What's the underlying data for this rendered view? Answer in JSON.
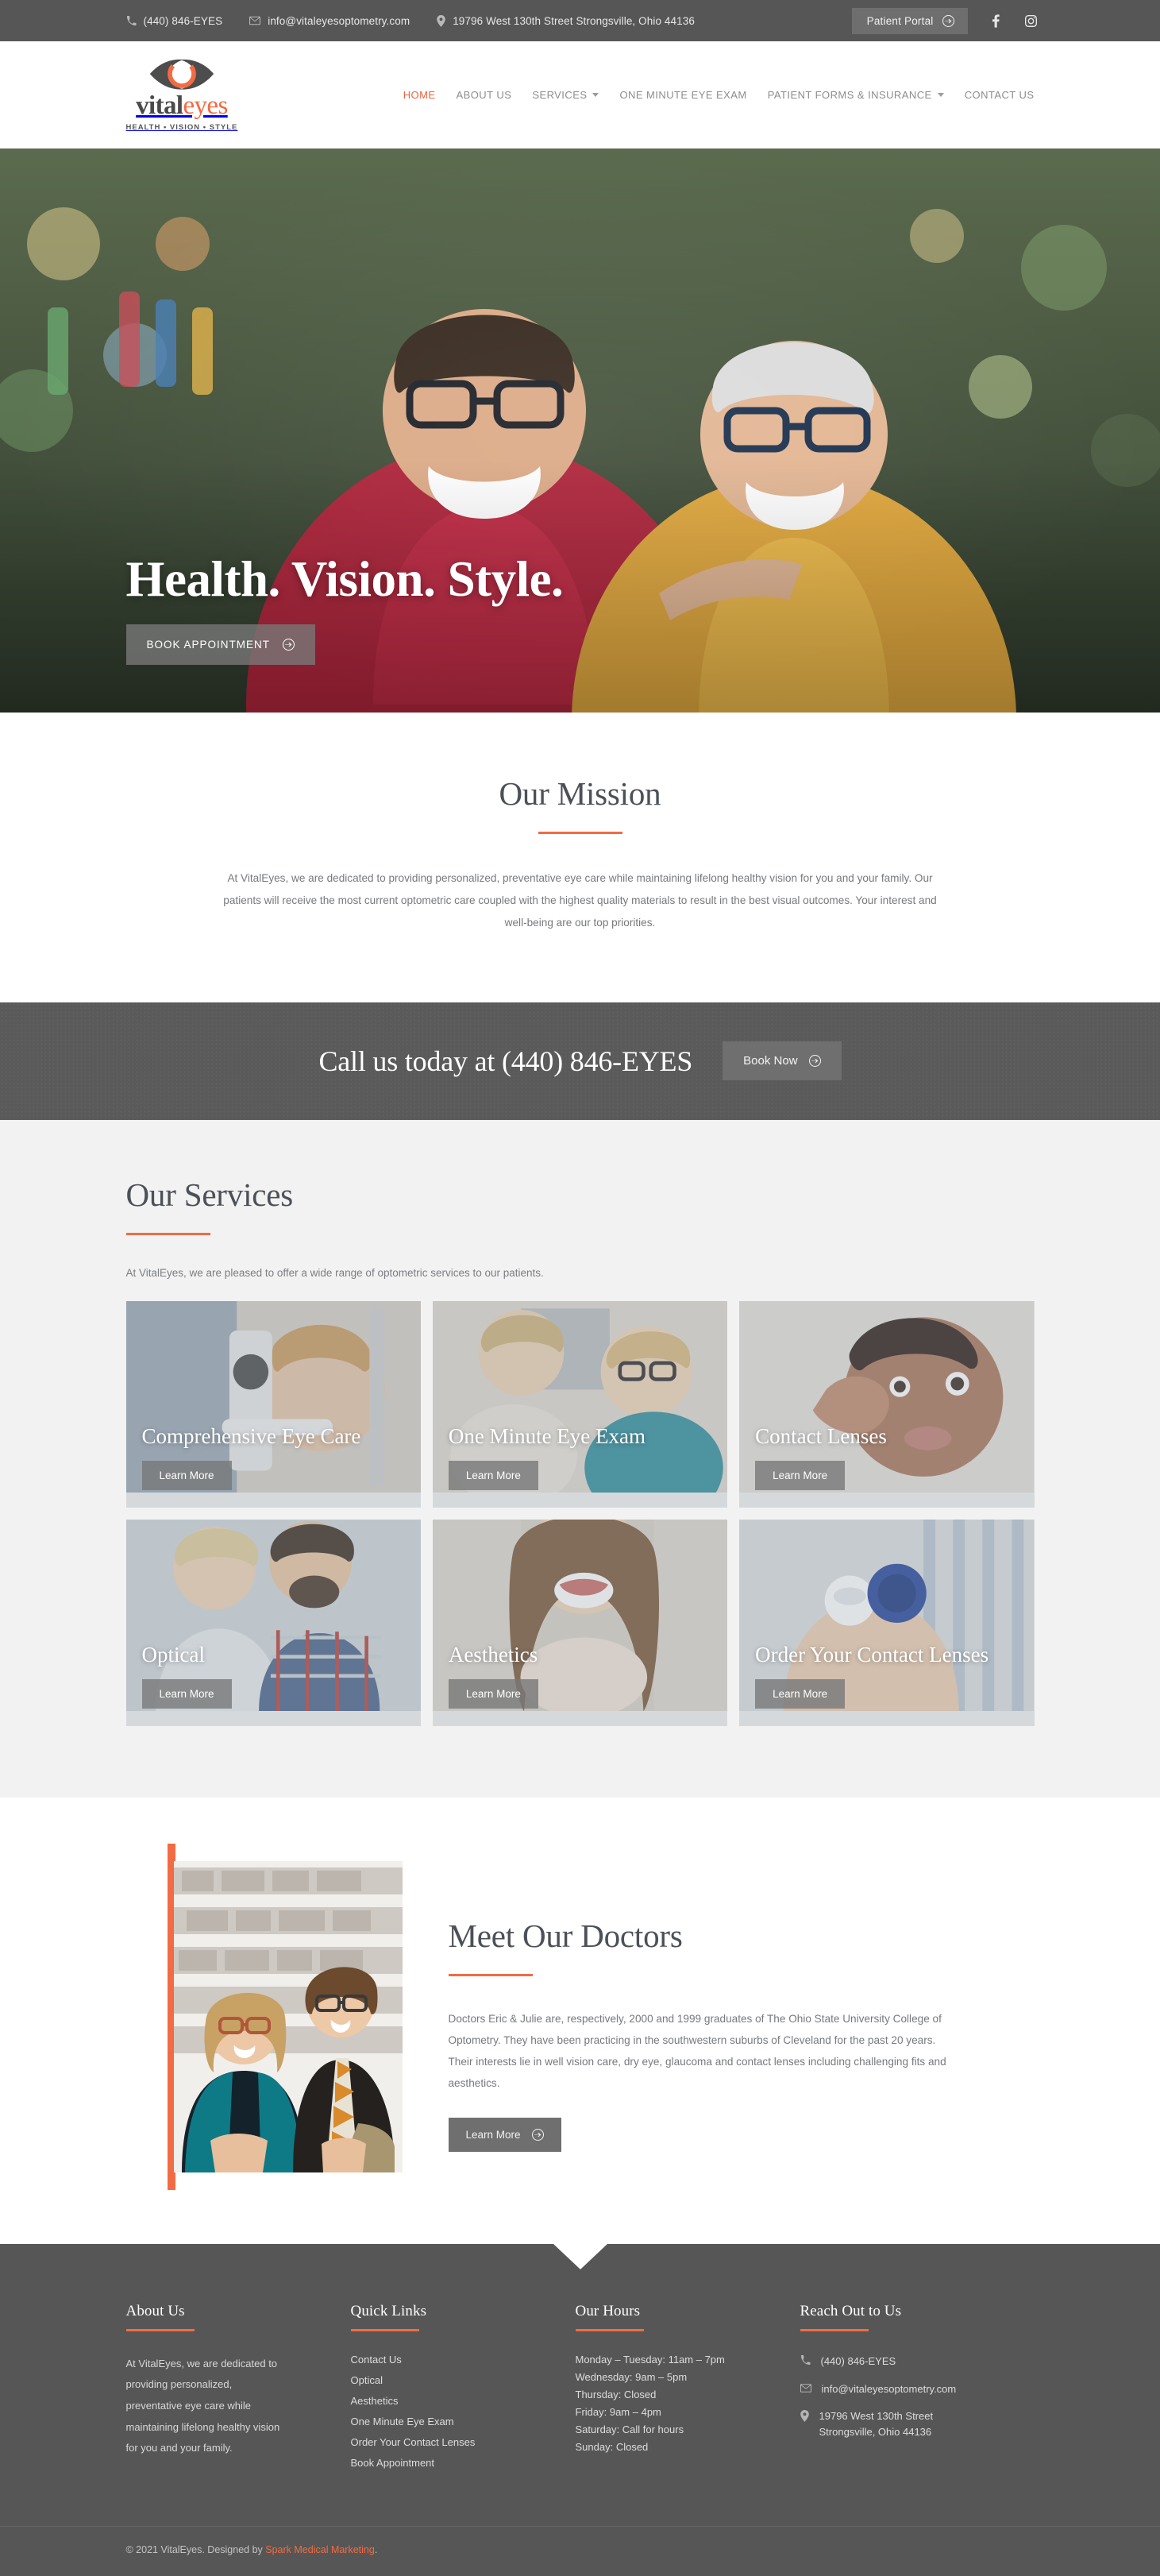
{
  "colors": {
    "accent": "#f26b42",
    "dark_gray": "#565656",
    "mid_gray": "#6f6f6f",
    "light_bg": "#f2f2f2",
    "heading": "#4c5057",
    "body_text": "#77797d"
  },
  "topbar": {
    "phone": "(440) 846-EYES",
    "email": "info@vitaleyesoptometry.com",
    "address": "19796 West 130th Street Strongsville, Ohio 44136",
    "portal_label": "Patient Portal",
    "social": [
      {
        "name": "facebook",
        "label": "f"
      },
      {
        "name": "instagram",
        "label": ""
      }
    ]
  },
  "header": {
    "logo": {
      "word_primary": "vital",
      "word_accent": "eyes",
      "tagline": "HEALTH • VISION • STYLE"
    },
    "nav": [
      {
        "label": "HOME",
        "active": true,
        "caret": false
      },
      {
        "label": "ABOUT US",
        "active": false,
        "caret": false
      },
      {
        "label": "SERVICES",
        "active": false,
        "caret": true
      },
      {
        "label": "ONE MINUTE EYE EXAM",
        "active": false,
        "caret": false
      },
      {
        "label": "PATIENT FORMS & INSURANCE",
        "active": false,
        "caret": true
      },
      {
        "label": "CONTACT US",
        "active": false,
        "caret": false
      }
    ]
  },
  "hero": {
    "title": "Health. Vision. Style.",
    "button_label": "BOOK APPOINTMENT"
  },
  "mission": {
    "title": "Our Mission",
    "text": "At VitalEyes, we are dedicated to providing personalized, preventative eye care while maintaining lifelong healthy vision for you and your family. Our patients will receive the most current optometric care coupled with the highest quality materials to result in the best visual outcomes. Your interest and well-being are our top priorities."
  },
  "callbar": {
    "text": "Call us today at (440) 846-EYES",
    "button_label": "Book Now"
  },
  "services": {
    "title": "Our Services",
    "subtitle": "At VitalEyes, we are pleased to offer a wide range of optometric services to our patients.",
    "learn_more_label": "Learn More",
    "cards": [
      {
        "title": "Comprehensive Eye Care",
        "button": "Learn More"
      },
      {
        "title": "One Minute Eye Exam",
        "button": "Learn More"
      },
      {
        "title": "Contact Lenses",
        "button": "Learn More"
      },
      {
        "title": "Optical",
        "button": "Learn More"
      },
      {
        "title": "Aesthetics",
        "button": "Learn More"
      },
      {
        "title": "Order Your Contact Lenses",
        "button": "Learn More"
      }
    ]
  },
  "doctors": {
    "title": "Meet Our Doctors",
    "text": "Doctors Eric & Julie are, respectively, 2000 and 1999 graduates of The Ohio State University College of Optometry. They have been practicing in the southwestern suburbs of Cleveland for the past 20 years. Their interests lie in well vision care, dry eye, glaucoma and contact lenses including challenging fits and aesthetics.",
    "button_label": "Learn More"
  },
  "footer": {
    "about": {
      "title": "About Us",
      "text": "At VitalEyes, we are dedicated to providing personalized, preventative eye care while maintaining lifelong healthy vision for you and your family."
    },
    "quick_links": {
      "title": "Quick Links",
      "items": [
        "Contact Us",
        "Optical",
        "Aesthetics",
        "One Minute Eye Exam",
        "Order Your Contact Lenses",
        "Book Appointment"
      ]
    },
    "hours": {
      "title": "Our Hours",
      "items": [
        "Monday – Tuesday: 11am – 7pm",
        "Wednesday: 9am – 5pm",
        "Thursday: Closed",
        "Friday: 9am – 4pm",
        "Saturday: Call for hours",
        "Sunday: Closed"
      ]
    },
    "reach": {
      "title": "Reach Out to Us",
      "phone": "(440) 846-EYES",
      "email": "info@vitaleyesoptometry.com",
      "address_line1": "19796 West 130th Street",
      "address_line2": "Strongsville, Ohio 44136"
    },
    "copyright_prefix": "© 2021 VitalEyes. Designed by ",
    "copyright_link": "Spark Medical Marketing",
    "copyright_suffix": "."
  }
}
